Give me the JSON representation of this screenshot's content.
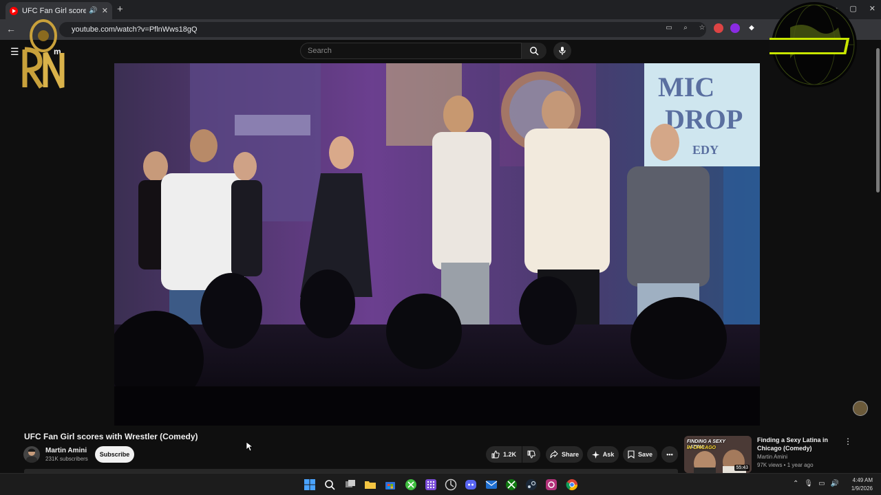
{
  "browser": {
    "tab_title": "UFC Fan Girl scores with Wr",
    "tab_close": "✕",
    "new_tab": "+",
    "url": "youtube.com/watch?v=PflnWws18gQ",
    "window_controls": [
      "—",
      "▢",
      "✕"
    ]
  },
  "youtube": {
    "logo_partial": "m",
    "search_placeholder": "Search"
  },
  "video": {
    "title": "UFC Fan Girl scores with Wrestler (Comedy)",
    "sign_text_top": "MIC",
    "sign_text_mid": "DROP",
    "sign_text_bottom": "EDY"
  },
  "channel": {
    "name": "Martin Amini",
    "subscribers": "231K subscribers",
    "subscribe_label": "Subscribe"
  },
  "actions": {
    "like_count": "1.2K",
    "share_label": "Share",
    "ask_label": "Ask",
    "save_label": "Save"
  },
  "recommendation": {
    "thumb_line1": "FINDING A SEXY LATINA",
    "thumb_line2": "IN CHICAGO",
    "duration": "55:43",
    "title": "Finding a Sexy Latina in Chicago (Comedy)",
    "channel": "Martin Amini",
    "meta": "97K views • 1 year ago"
  },
  "taskbar": {
    "time": "4:49 AM",
    "date": "1/9/2026",
    "icons": [
      "windows-start",
      "search",
      "task-view",
      "file-explorer",
      "store",
      "xbox-app",
      "apps-grid",
      "photo-app",
      "discord",
      "mail",
      "xbox",
      "steam",
      "photo-editor",
      "chrome"
    ]
  },
  "colors": {
    "youtube_red": "#ff0000",
    "background": "#0f0f0f",
    "spin_logo_yellow": "#e6ff00",
    "rn_logo_gold": "#c9a13b"
  }
}
